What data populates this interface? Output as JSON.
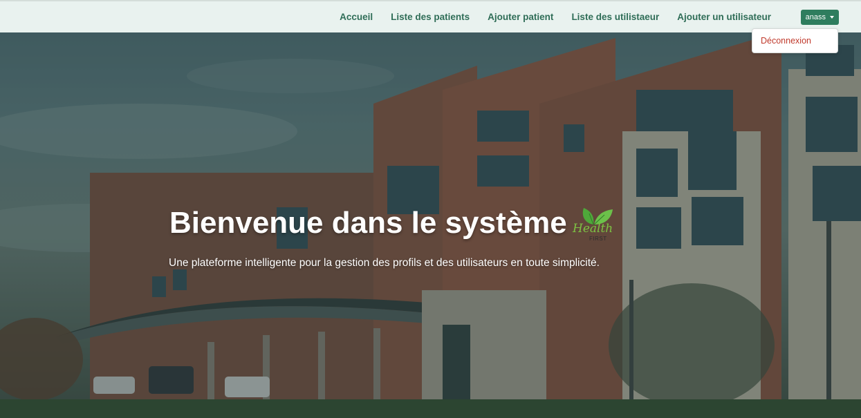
{
  "navbar": {
    "links": [
      {
        "label": "Accueil"
      },
      {
        "label": "Liste des patients"
      },
      {
        "label": "Ajouter patient"
      },
      {
        "label": "Liste des utilistaeur"
      },
      {
        "label": "Ajouter un utilisateur"
      }
    ],
    "user": {
      "name": "anass",
      "icon": "caret-down-icon"
    },
    "dropdown": {
      "logout_label": "Déconnexion"
    }
  },
  "hero": {
    "title": "Bienvenue dans le système",
    "subtitle": "Une plateforme intelligente pour la gestion des profils et des utilisateurs en toute simplicité.",
    "background": "hospital-building-photo",
    "logo": {
      "text": "Health",
      "subtext": "FIRST",
      "icon": "leaf-logo-icon"
    }
  },
  "colors": {
    "navbar_bg": "#e9f2ef",
    "nav_link": "#2f6d57",
    "user_button": "#2e7d5e",
    "logout_text": "#c0392b",
    "logo_green": "#7dc243"
  }
}
